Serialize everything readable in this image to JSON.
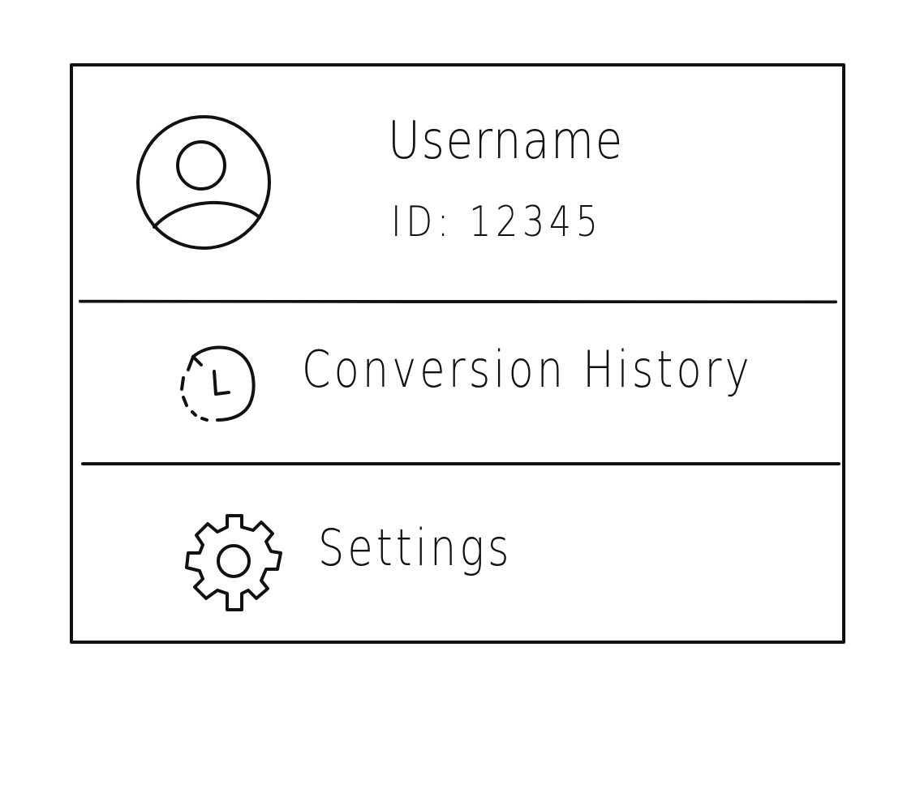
{
  "profile": {
    "username": "Username",
    "id_text": "ID: 12345",
    "avatar_icon": "user-avatar-icon"
  },
  "menu": {
    "items": [
      {
        "label": "Conversion History",
        "icon": "history-icon"
      },
      {
        "label": "Settings",
        "icon": "gear-icon"
      }
    ]
  },
  "colors": {
    "stroke": "#111111",
    "background": "#ffffff"
  }
}
